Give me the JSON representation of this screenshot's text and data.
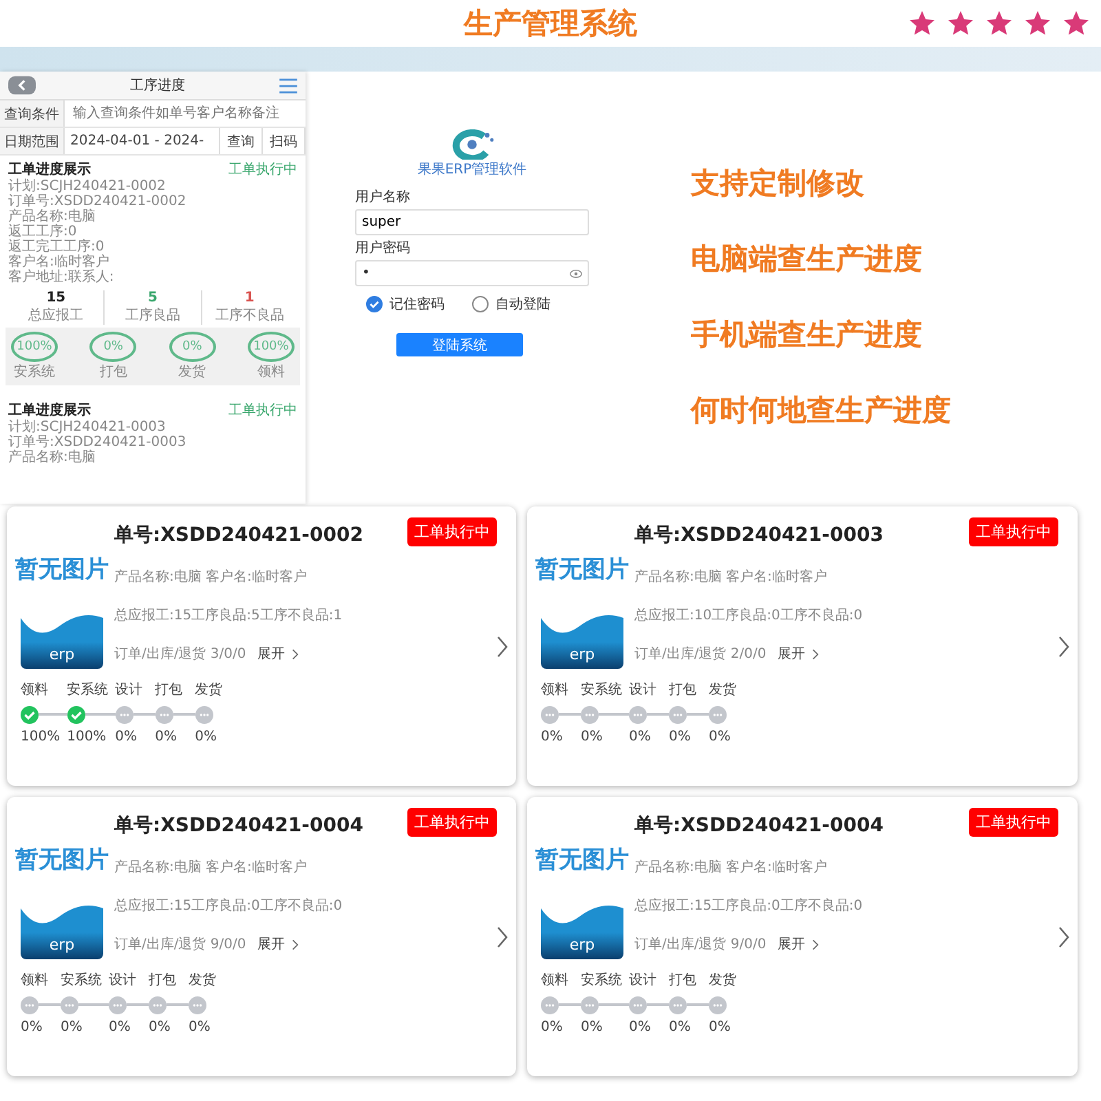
{
  "header": {
    "title": "生产管理系统",
    "stars": 5
  },
  "phone": {
    "title": "工序进度",
    "query_label": "查询条件",
    "query_placeholder": "输入查询条件如单号客户名称备注",
    "date_label": "日期范围",
    "date_value": "2024-04-01 - 2024-",
    "buttons": [
      "查询",
      "扫码"
    ],
    "orders": [
      {
        "title": "工单进度展示",
        "status": "工单执行中",
        "lines": [
          "计划:SCJH240421-0002",
          "订单号:XSDD240421-0002",
          "产品名称:电脑",
          "返工工序:0",
          "返工完工工序:0",
          "客户名:临时客户",
          "客户地址:联系人:"
        ],
        "stats": [
          {
            "value": "15",
            "label": "总应报工",
            "kind": "total"
          },
          {
            "value": "5",
            "label": "工序良品",
            "kind": "good"
          },
          {
            "value": "1",
            "label": "工序不良品",
            "kind": "bad"
          }
        ],
        "steps": [
          {
            "percent": "100%",
            "label": "安系统"
          },
          {
            "percent": "0%",
            "label": "打包"
          },
          {
            "percent": "0%",
            "label": "发货"
          },
          {
            "percent": "100%",
            "label": "领料"
          }
        ]
      },
      {
        "title": "工单进度展示",
        "status": "工单执行中",
        "lines": [
          "计划:SCJH240421-0003",
          "订单号:XSDD240421-0003",
          "产品名称:电脑"
        ]
      }
    ]
  },
  "login": {
    "app_name": "果果ERP管理软件",
    "username_label": "用户名称",
    "username": "super",
    "password_label": "用户密码",
    "password": "•",
    "options": [
      {
        "label": "记住密码",
        "checked": true
      },
      {
        "label": "自动登陆",
        "checked": false
      }
    ],
    "submit": "登陆系统"
  },
  "features": [
    "支持定制修改",
    "电脑端查生产进度",
    "手机端查生产进度",
    "何时何地查生产进度"
  ],
  "cards": [
    {
      "order_no": "单号:XSDD240421-0002",
      "status": "工单执行中",
      "image_text": "暂无图片",
      "image_caption": "erp",
      "product": "产品名称:电脑 客户名:临时客户",
      "report": "总应报工:15工序良品:5工序不良品:1",
      "counts": "订单/出库/退货 3/0/0",
      "expand": "展开",
      "steps": [
        {
          "label": "领料",
          "done": true,
          "percent": "100%"
        },
        {
          "label": "安系统",
          "done": true,
          "percent": "100%"
        },
        {
          "label": "设计",
          "done": false,
          "percent": "0%"
        },
        {
          "label": "打包",
          "done": false,
          "percent": "0%"
        },
        {
          "label": "发货",
          "done": false,
          "percent": "0%"
        }
      ]
    },
    {
      "order_no": "单号:XSDD240421-0003",
      "status": "工单执行中",
      "image_text": "暂无图片",
      "image_caption": "erp",
      "product": "产品名称:电脑 客户名:临时客户",
      "report": "总应报工:10工序良品:0工序不良品:0",
      "counts": "订单/出库/退货 2/0/0",
      "expand": "展开",
      "steps": [
        {
          "label": "领料",
          "done": false,
          "percent": "0%"
        },
        {
          "label": "安系统",
          "done": false,
          "percent": "0%"
        },
        {
          "label": "设计",
          "done": false,
          "percent": "0%"
        },
        {
          "label": "打包",
          "done": false,
          "percent": "0%"
        },
        {
          "label": "发货",
          "done": false,
          "percent": "0%"
        }
      ]
    },
    {
      "order_no": "单号:XSDD240421-0004",
      "status": "工单执行中",
      "image_text": "暂无图片",
      "image_caption": "erp",
      "product": "产品名称:电脑 客户名:临时客户",
      "report": "总应报工:15工序良品:0工序不良品:0",
      "counts": "订单/出库/退货 9/0/0",
      "expand": "展开",
      "steps": [
        {
          "label": "领料",
          "done": false,
          "percent": "0%"
        },
        {
          "label": "安系统",
          "done": false,
          "percent": "0%"
        },
        {
          "label": "设计",
          "done": false,
          "percent": "0%"
        },
        {
          "label": "打包",
          "done": false,
          "percent": "0%"
        },
        {
          "label": "发货",
          "done": false,
          "percent": "0%"
        }
      ]
    },
    {
      "order_no": "单号:XSDD240421-0004",
      "status": "工单执行中",
      "image_text": "暂无图片",
      "image_caption": "erp",
      "product": "产品名称:电脑 客户名:临时客户",
      "report": "总应报工:15工序良品:0工序不良品:0",
      "counts": "订单/出库/退货 9/0/0",
      "expand": "展开",
      "steps": [
        {
          "label": "领料",
          "done": false,
          "percent": "0%"
        },
        {
          "label": "安系统",
          "done": false,
          "percent": "0%"
        },
        {
          "label": "设计",
          "done": false,
          "percent": "0%"
        },
        {
          "label": "打包",
          "done": false,
          "percent": "0%"
        },
        {
          "label": "发货",
          "done": false,
          "percent": "0%"
        }
      ]
    }
  ]
}
